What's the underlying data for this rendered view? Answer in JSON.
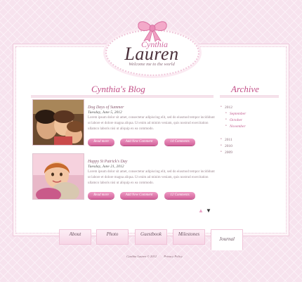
{
  "logo": {
    "name_line1": "Cynthia",
    "name_line2": "Lauren",
    "tagline": "Welcome me to the world"
  },
  "blog": {
    "title": "Cynthia's Blog",
    "posts": [
      {
        "title": "Dog Days of Summer",
        "date": "Tuesday, June 5, 2012",
        "body": "Lorem ipsum dolor sit amet, consectetur adipiscing elit, sed do eiusmod tempor incididunt ut labore et dolore magna aliqua. Ut enim ad minim veniam, quis nostrud exercitation ullamco laboris nisi ut aliquip ex ea commodo.",
        "buttons": [
          "Read more",
          "Add New Comment",
          "14 Comments"
        ]
      },
      {
        "title": "Happy St Patrick's Day",
        "date": "Tuesday, June 21, 2012",
        "body": "Lorem ipsum dolor sit amet, consectetur adipiscing elit, sed do eiusmod tempor incididunt ut labore et dolore magna aliqua. Ut enim ad minim veniam, quis nostrud exercitation ullamco laboris nisi ut aliquip ex ea commodo.",
        "buttons": [
          "Read more",
          "Add New Comment",
          "12 Comments"
        ]
      }
    ]
  },
  "archive": {
    "title": "Archive",
    "years_top": [
      "2012"
    ],
    "months": [
      "September",
      "October",
      "November"
    ],
    "years_bottom": [
      "2011",
      "2010",
      "2009"
    ]
  },
  "nav": {
    "tabs": [
      "About",
      "Photo",
      "Guestbook",
      "Milestones",
      "Journal"
    ],
    "active": "Journal"
  },
  "footer": {
    "copyright": "Cynthia Lauren © 2012",
    "privacy": "Privacy Policy"
  },
  "colors": {
    "accent": "#c24f87",
    "background": "#f7e3ee",
    "button": "#d2619a"
  }
}
